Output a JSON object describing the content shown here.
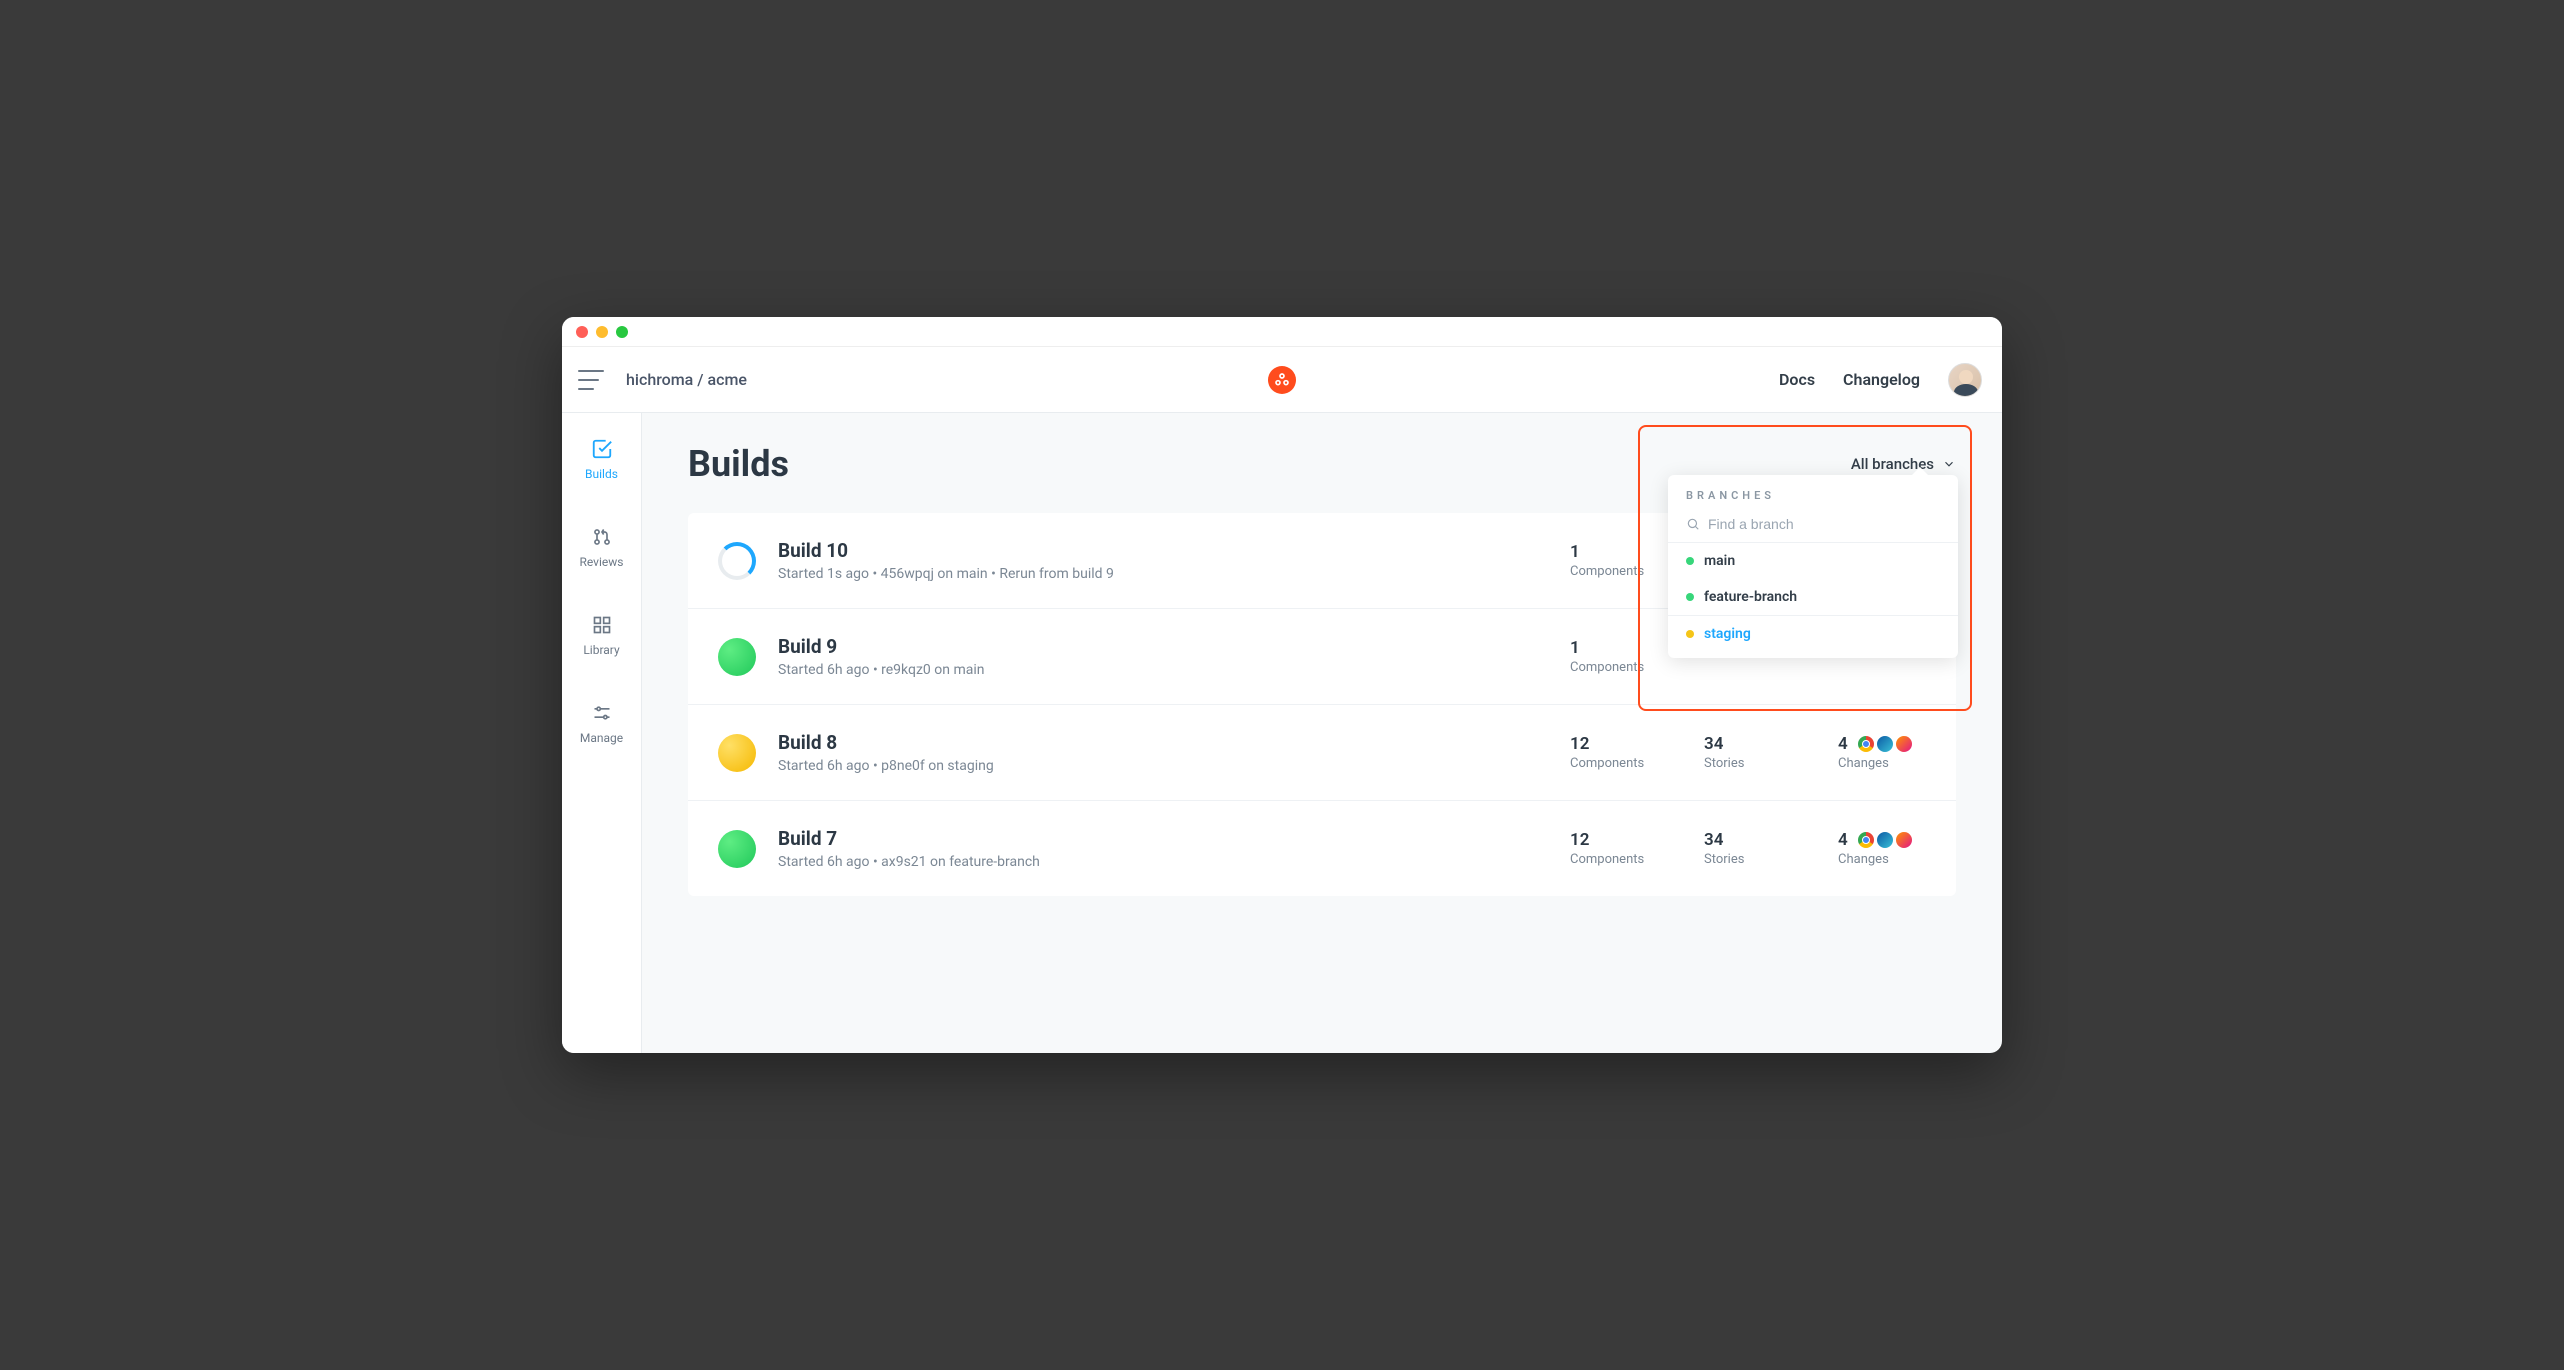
{
  "breadcrumb": "hichroma / acme",
  "topbar": {
    "docs": "Docs",
    "changelog": "Changelog"
  },
  "sidebar": {
    "builds": "Builds",
    "reviews": "Reviews",
    "library": "Library",
    "manage": "Manage"
  },
  "page_title": "Builds",
  "branch_selector_label": "All branches",
  "dropdown": {
    "header": "BRANCHES",
    "search_placeholder": "Find a branch",
    "items": [
      {
        "label": "main",
        "dot": "green",
        "active": false
      },
      {
        "label": "feature-branch",
        "dot": "green",
        "active": false
      },
      {
        "label": "staging",
        "dot": "yellow",
        "active": true
      }
    ]
  },
  "stat_labels": {
    "components": "Components",
    "stories": "Stories",
    "changes": "Changes"
  },
  "builds": [
    {
      "title": "Build 10",
      "sub": "Started 1s ago • 456wpqj on main • Rerun from build 9",
      "status": "spinner",
      "components": "1",
      "stories": "",
      "changes": ""
    },
    {
      "title": "Build 9",
      "sub": "Started 6h ago • re9kqz0 on main",
      "status": "green",
      "components": "1",
      "stories": "",
      "changes": ""
    },
    {
      "title": "Build 8",
      "sub": "Started 6h ago • p8ne0f on staging",
      "status": "yellow",
      "components": "12",
      "stories": "34",
      "changes": "4"
    },
    {
      "title": "Build 7",
      "sub": "Started 6h ago • ax9s21 on feature-branch",
      "status": "green",
      "components": "12",
      "stories": "34",
      "changes": "4"
    }
  ]
}
